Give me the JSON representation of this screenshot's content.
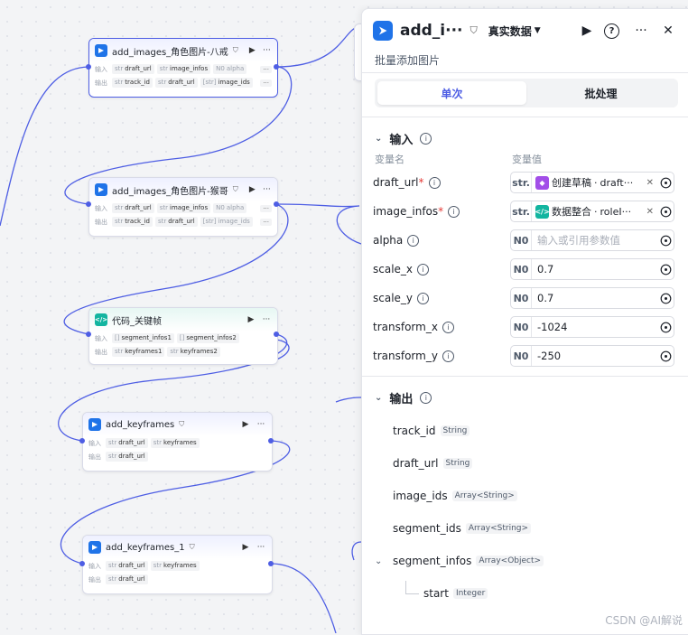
{
  "canvas": {
    "nodes": [
      {
        "title": "add_images_角色图片-八戒",
        "icon": "plugin",
        "inputs_label": "输入",
        "outputs_label": "输出",
        "inputs": [
          {
            "t": "str",
            "v": "draft_url"
          },
          {
            "t": "str",
            "v": "image_infos"
          },
          {
            "t": "N0",
            "v": "alpha",
            "muted": true
          }
        ],
        "outputs": [
          {
            "t": "str",
            "v": "track_id"
          },
          {
            "t": "str",
            "v": "draft_url"
          },
          {
            "t": "[str]",
            "v": "image_ids",
            "muted": true
          }
        ]
      },
      {
        "title": "add_images_角色图片-猴哥",
        "icon": "plugin",
        "inputs_label": "输入",
        "outputs_label": "输出",
        "inputs": [
          {
            "t": "str",
            "v": "draft_url"
          },
          {
            "t": "str",
            "v": "image_infos"
          },
          {
            "t": "N0",
            "v": "alpha",
            "muted": true
          }
        ],
        "outputs": [
          {
            "t": "str",
            "v": "track_id"
          },
          {
            "t": "str",
            "v": "draft_url"
          },
          {
            "t": "[str]",
            "v": "image_ids",
            "muted": true
          }
        ]
      },
      {
        "title": "代码_关键帧",
        "icon": "code",
        "inputs_label": "输入",
        "outputs_label": "输出",
        "inputs": [
          {
            "t": "[]",
            "v": "segment_infos1"
          },
          {
            "t": "[]",
            "v": "segment_infos2"
          }
        ],
        "outputs": [
          {
            "t": "str",
            "v": "keyframes1"
          },
          {
            "t": "str",
            "v": "keyframes2"
          }
        ]
      },
      {
        "title": "add_keyframes",
        "icon": "plugin",
        "inputs_label": "输入",
        "outputs_label": "输出",
        "inputs": [
          {
            "t": "str",
            "v": "draft_url"
          },
          {
            "t": "str",
            "v": "keyframes"
          }
        ],
        "outputs": [
          {
            "t": "str",
            "v": "draft_url"
          }
        ]
      },
      {
        "title": "add_keyframes_1",
        "icon": "plugin",
        "inputs_label": "输入",
        "outputs_label": "输出",
        "inputs": [
          {
            "t": "str",
            "v": "draft_url"
          },
          {
            "t": "str",
            "v": "keyframes"
          }
        ],
        "outputs": [
          {
            "t": "str",
            "v": "draft_url"
          }
        ]
      }
    ]
  },
  "panel": {
    "title": "add_i···",
    "mode": "真实数据",
    "subtitle": "批量添加图片",
    "tabs": [
      {
        "label": "单次",
        "active": true
      },
      {
        "label": "批处理",
        "active": false
      }
    ],
    "input_section": "输入",
    "col_name": "变量名",
    "col_value": "变量值",
    "inputs": [
      {
        "name": "draft_url",
        "required": true,
        "type": "str.",
        "kind": "ref",
        "ref_node": "创建草稿",
        "ref_field": "draft···",
        "ref_color": "#a24ee8"
      },
      {
        "name": "image_infos",
        "required": true,
        "type": "str.",
        "kind": "ref",
        "ref_node": "数据整合",
        "ref_field": "roleI···",
        "ref_color": "#13b5a0"
      },
      {
        "name": "alpha",
        "required": false,
        "type": "N0",
        "kind": "empty",
        "placeholder": "输入或引用参数值"
      },
      {
        "name": "scale_x",
        "required": false,
        "type": "N0",
        "kind": "value",
        "value": "0.7"
      },
      {
        "name": "scale_y",
        "required": false,
        "type": "N0",
        "kind": "value",
        "value": "0.7"
      },
      {
        "name": "transform_x",
        "required": false,
        "type": "N0",
        "kind": "value",
        "value": "-1024"
      },
      {
        "name": "transform_y",
        "required": false,
        "type": "N0",
        "kind": "value",
        "value": "-250"
      }
    ],
    "output_section": "输出",
    "outputs": [
      {
        "name": "track_id",
        "type": "String"
      },
      {
        "name": "draft_url",
        "type": "String"
      },
      {
        "name": "image_ids",
        "type": "Array<String>"
      },
      {
        "name": "segment_ids",
        "type": "Array<String>"
      },
      {
        "name": "segment_infos",
        "type": "Array<Object>",
        "expandable": true
      },
      {
        "name": "start",
        "type": "Integer",
        "child": true
      }
    ]
  },
  "watermark": "CSDN @AI解说",
  "colors": {
    "accent": "#4e5ee4",
    "edge": "#4e5ee4",
    "plugin_icon": "#1f73e8",
    "code_icon": "#13b5a0"
  }
}
